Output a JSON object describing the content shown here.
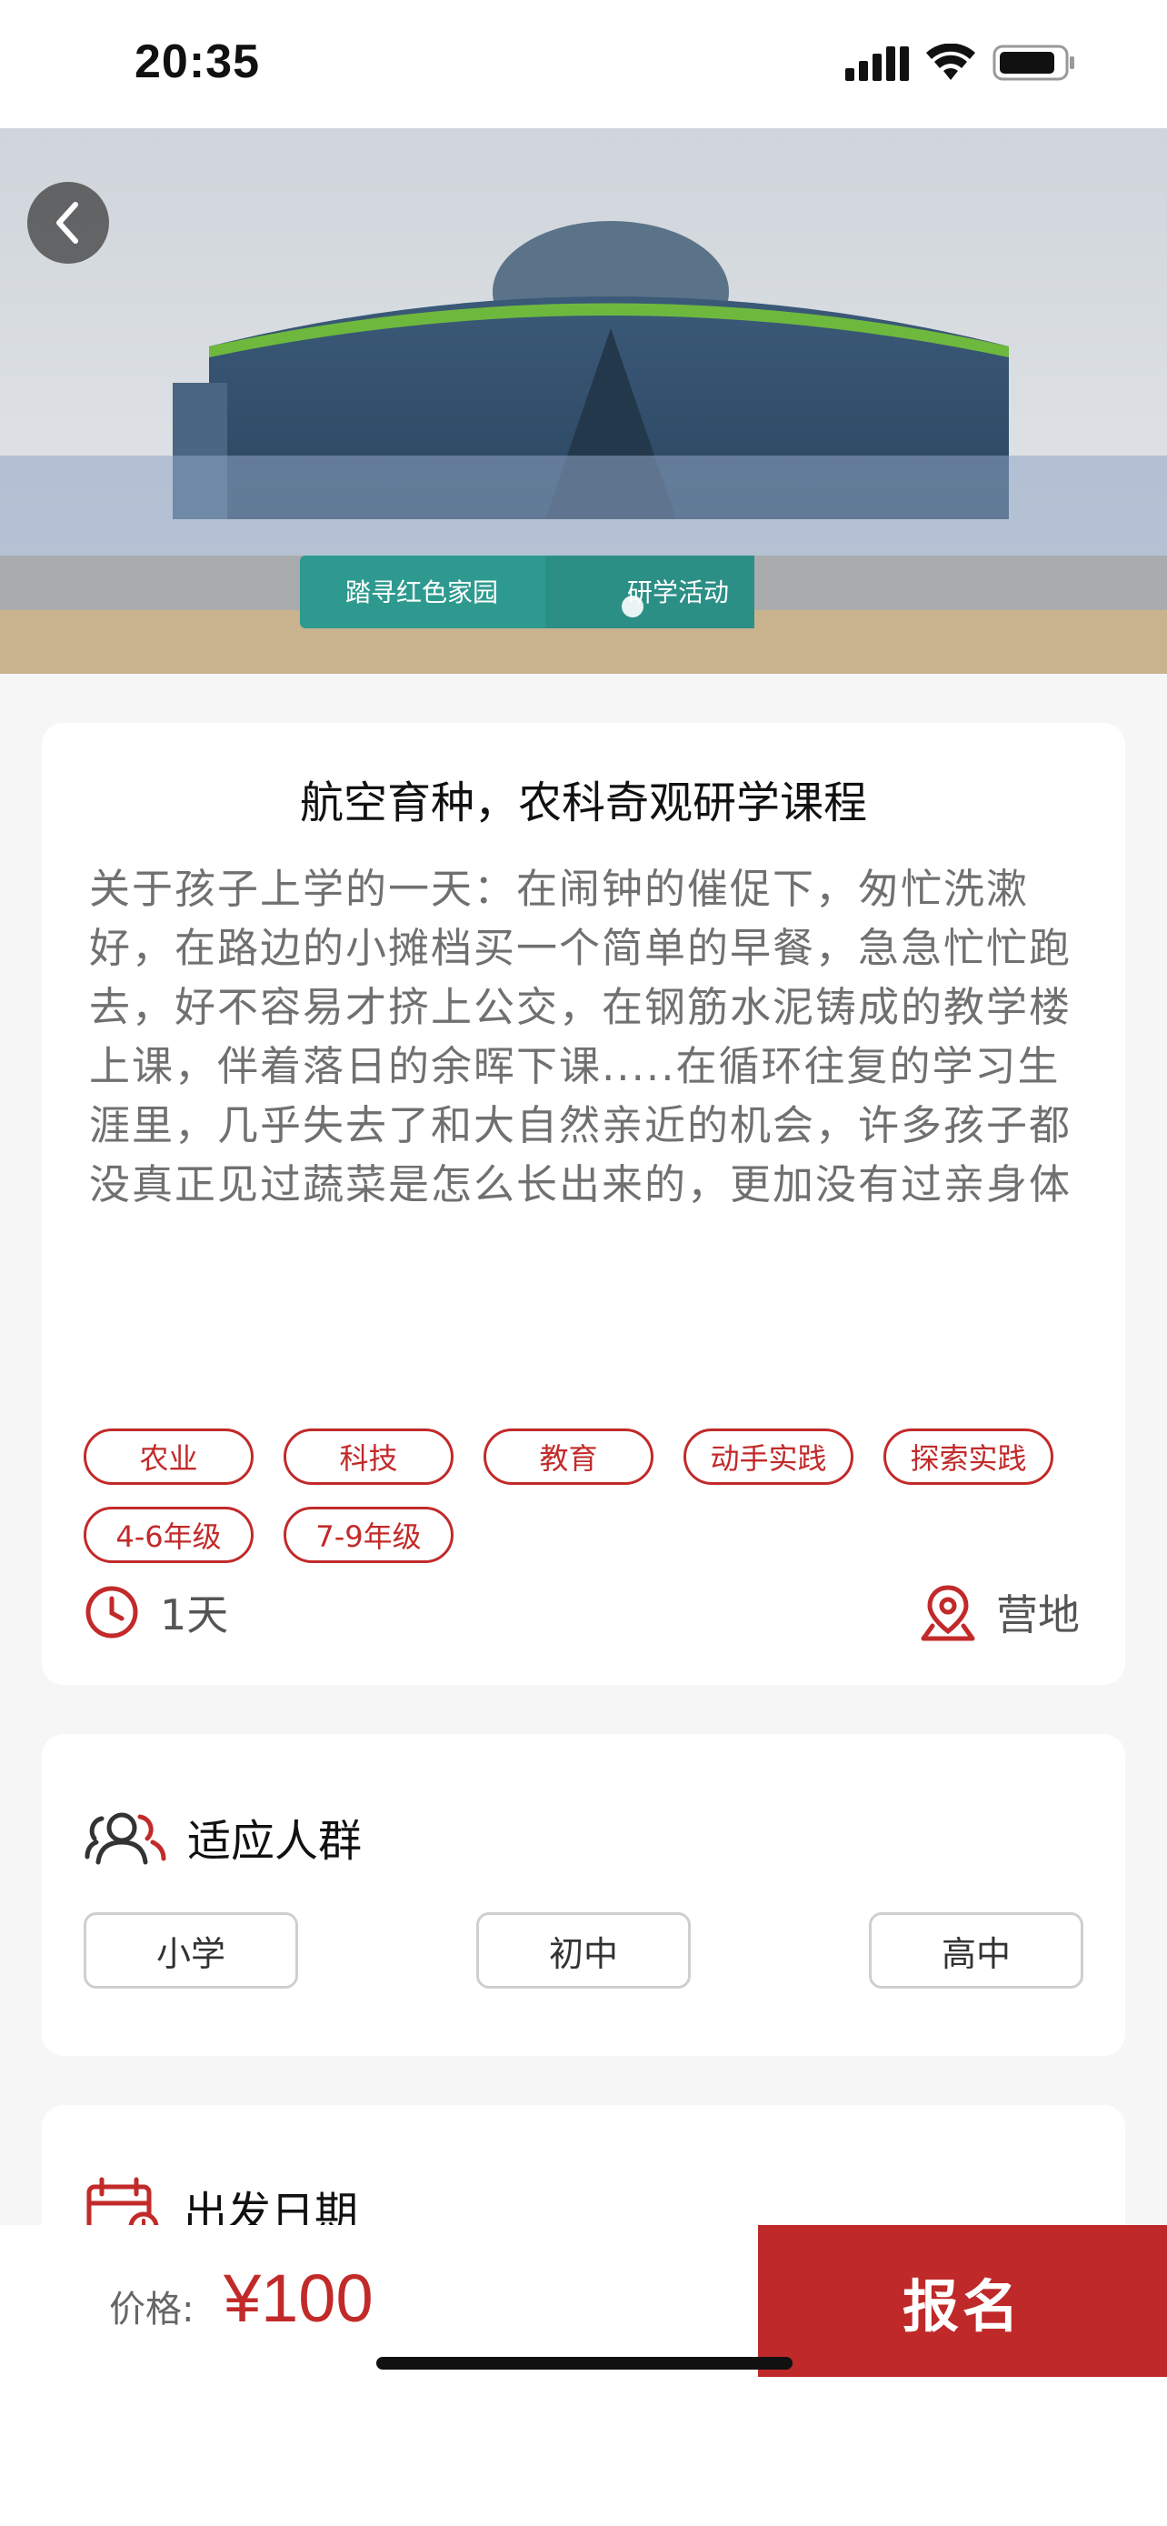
{
  "status_bar": {
    "time": "20:35"
  },
  "hero": {
    "banner_text_left": "踏寻红色家园",
    "banner_text_right": "研学活动",
    "carousel_dots": 1
  },
  "course": {
    "title": "航空育种，农科奇观研学课程",
    "description": "关于孩子上学的一天：在闹钟的催促下，匆忙洗漱好，在路边的小摊档买一个简单的早餐，急急忙忙跑去，好不容易才挤上公交，在钢筋水泥铸成的教学楼上课，伴着落日的余晖下课.....在循环往复的学习生涯里，几乎失去了和大自然亲近的机会，许多孩子都没真正见过蔬菜是怎么长出来的，更加没有过亲身体验田间采摘、动手做食物的经历。在这里，除了上述的活动之外，还能看到无公害蔬菜是怎么培植的，如何吃出健康",
    "tags": [
      "农业",
      "科技",
      "教育",
      "动手实践",
      "探索实践",
      "4-6年级",
      "7-9年级"
    ],
    "duration": "1天",
    "location": "营地"
  },
  "audience": {
    "title": "适应人群",
    "options": [
      "小学",
      "初中",
      "高中"
    ]
  },
  "departure": {
    "title": "出发日期"
  },
  "bottom": {
    "price_label": "价格:",
    "price": "¥100",
    "signup_label": "报名"
  },
  "colors": {
    "accent": "#bf2929",
    "background": "#f6f6f6"
  }
}
